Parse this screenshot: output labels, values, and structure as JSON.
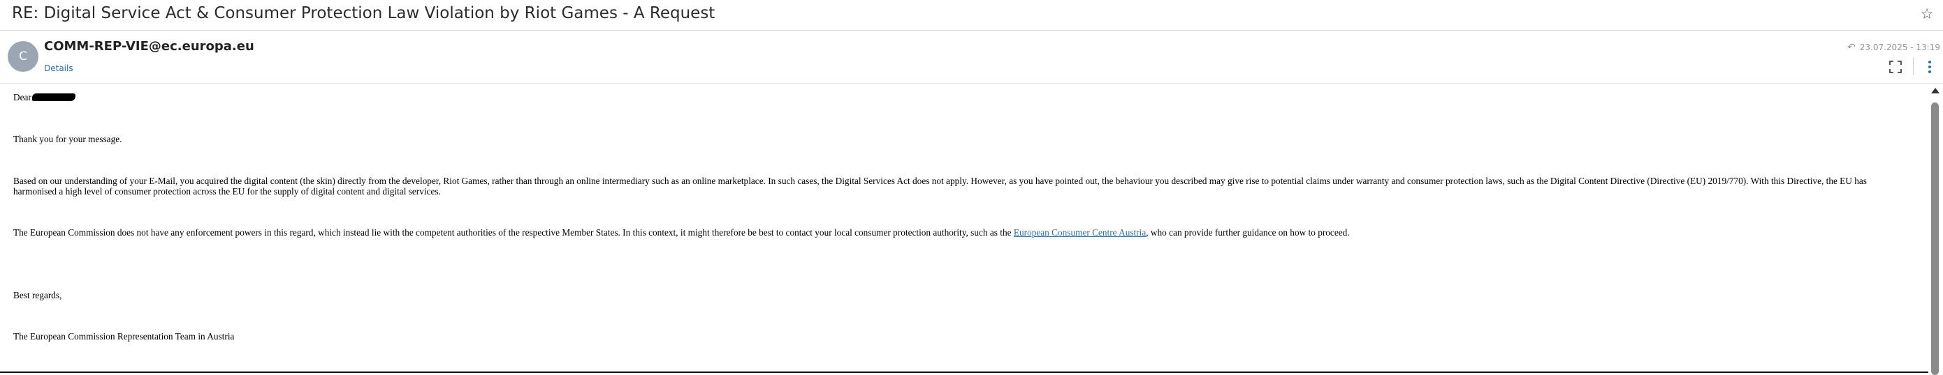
{
  "email": {
    "subject": "RE: Digital Service Act & Consumer Protection Law Violation by Riot Games - A Request",
    "sender": "COMM-REP-VIE@ec.europa.eu",
    "avatar_initial": "C",
    "details_label": "Details",
    "date": "23.07.2025 - 13:19"
  },
  "body": {
    "greeting": "Dear",
    "para1": "Thank you for your message.",
    "para2": "Based on our understanding of your E-Mail, you acquired the digital content (the skin) directly from the developer, Riot Games, rather than through an online intermediary such as an online marketplace. In such cases, the Digital Services Act does not apply. However, as you have pointed out, the behaviour you described may give rise to potential claims under warranty and consumer protection laws, such as the Digital Content Directive (Directive (EU) 2019/770). With this Directive, the EU has harmonised a high level of consumer protection across the EU for the supply of digital content and digital services.",
    "para3_before": "The European Commission does not have any enforcement powers in this regard, which instead lie with the competent authorities of the respective Member States. In this context, it might therefore be best to contact your local consumer protection authority, such as the ",
    "para3_link": "European Consumer Centre Austria",
    "para3_after": ", who can provide further guidance on how to proceed.",
    "closing": "Best regards,",
    "signature": "The European Commission Representation Team in Austria"
  },
  "icons": {
    "star": "star-icon",
    "reply": "reply-icon",
    "expand": "expand-icon",
    "more": "kebab-menu-icon"
  },
  "colors": {
    "link": "#2d6da3",
    "avatar": "#9aa6b4",
    "muted": "#8c939b"
  }
}
